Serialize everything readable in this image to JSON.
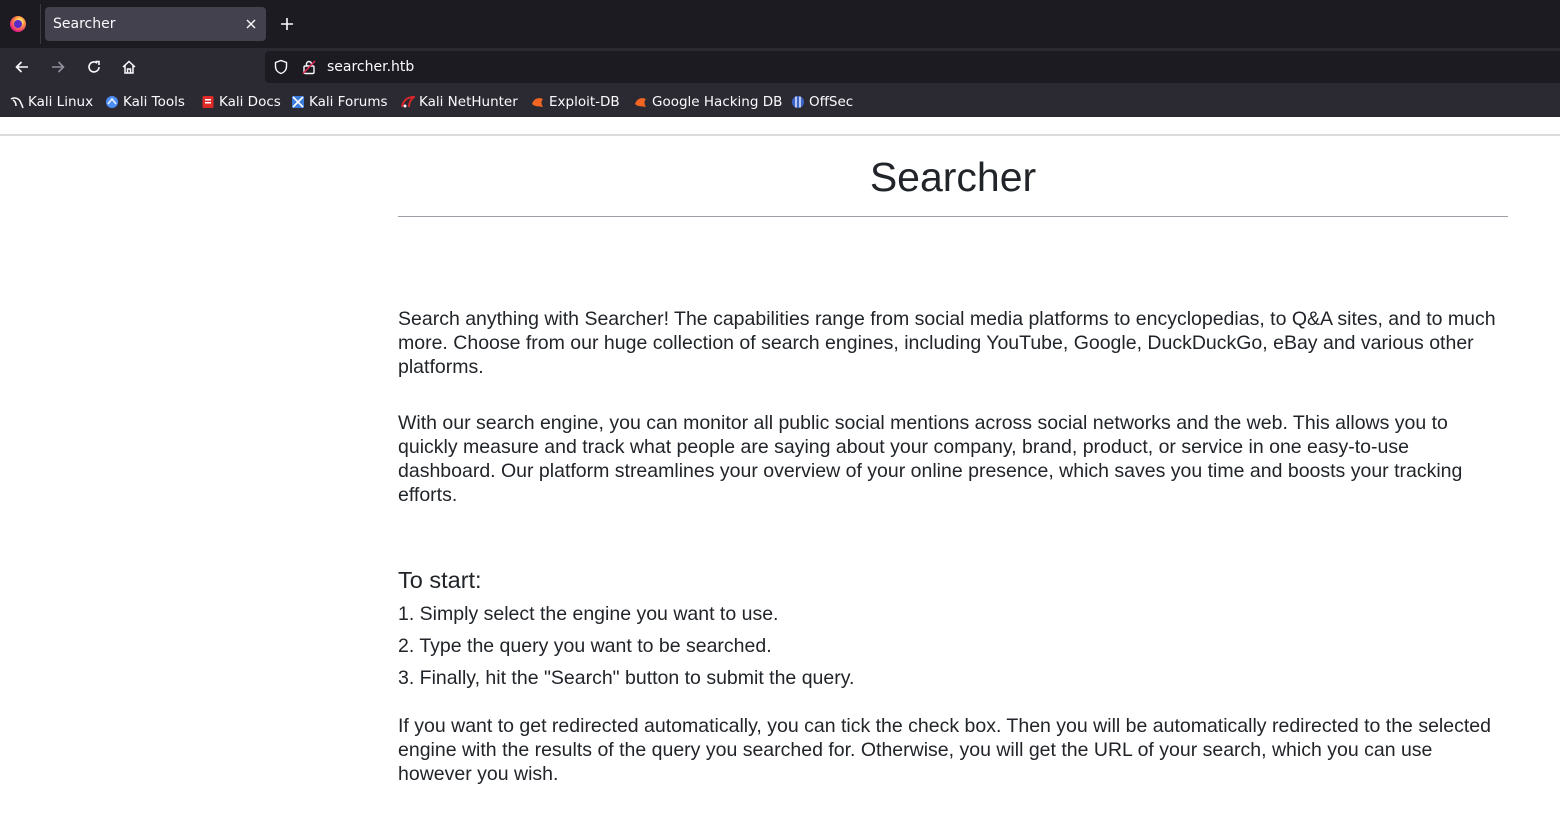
{
  "browser": {
    "tab_title": "Searcher",
    "url": "searcher.htb",
    "bookmarks": [
      {
        "label": "Kali Linux",
        "icon": "kali-dragon-icon",
        "color": "#ffffff"
      },
      {
        "label": "Kali Tools",
        "icon": "kali-tools-icon",
        "color": "#4d8ef7"
      },
      {
        "label": "Kali Docs",
        "icon": "kali-docs-icon",
        "color": "#e02a2a"
      },
      {
        "label": "Kali Forums",
        "icon": "kali-forums-icon",
        "color": "#3b7bdc"
      },
      {
        "label": "Kali NetHunter",
        "icon": "kali-nethunter-icon",
        "color": "#d9262b"
      },
      {
        "label": "Exploit-DB",
        "icon": "exploit-db-icon",
        "color": "#f26522"
      },
      {
        "label": "Google Hacking DB",
        "icon": "ghdb-icon",
        "color": "#f26522"
      },
      {
        "label": "OffSec",
        "icon": "offsec-icon",
        "color": "#3c63c9"
      }
    ]
  },
  "page": {
    "title": "Searcher",
    "intro_paragraphs": [
      "Search anything with Searcher! The capabilities range from social media platforms to encyclopedias, to Q&A sites, and to much more. Choose from our huge collection of search engines, including YouTube, Google, DuckDuckGo, eBay and various other platforms.",
      "With our search engine, you can monitor all public social mentions across social networks and the web. This allows you to quickly measure and track what people are saying about your company, brand, product, or service in one easy-to-use dashboard. Our platform streamlines your overview of your online presence, which saves you time and boosts your tracking efforts."
    ],
    "start_heading": "To start:",
    "steps": [
      "1. Simply select the engine you want to use.",
      "2. Type the query you want to be searched.",
      "3. Finally, hit the \"Search\" button to submit the query."
    ],
    "closing_paragraph": "If you want to get redirected automatically, you can tick the check box. Then you will be automatically redirected to the selected engine with the results of the query you searched for. Otherwise, you will get the URL of your search, which you can use however you wish."
  }
}
